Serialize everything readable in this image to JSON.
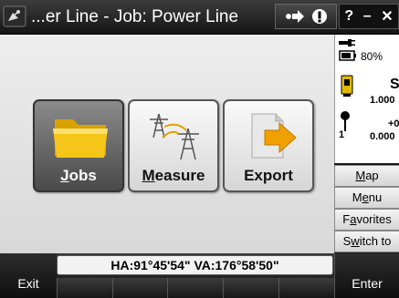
{
  "title": "...er Line - Job: Power Line",
  "titlebar": {
    "help": "?",
    "minimize": "–",
    "close": "✕"
  },
  "tiles": [
    {
      "label_first": "J",
      "label_rest": "obs",
      "icon": "folder-icon"
    },
    {
      "label_first": "M",
      "label_rest": "easure",
      "icon": "survey-towers-icon"
    },
    {
      "label_first": "",
      "label_rest": "Export",
      "icon": "export-arrow-icon"
    }
  ],
  "status": {
    "battery_percent": "80%",
    "s_label": "S",
    "value1": "1.000",
    "plus0": "+0",
    "value2": "0.000",
    "satellite_count": "1"
  },
  "side_buttons": [
    {
      "pre": "",
      "u": "M",
      "post": "ap"
    },
    {
      "pre": "M",
      "u": "e",
      "post": "nu"
    },
    {
      "pre": "F",
      "u": "a",
      "post": "vorites"
    },
    {
      "pre": "S",
      "u": "w",
      "post": "itch to"
    }
  ],
  "readout": "HA:91°45'54\"  VA:176°58'50\"",
  "footer": {
    "exit": "Exit",
    "enter": "Enter"
  },
  "colors": {
    "folder": "#f5c518",
    "export_arrow": "#f0a000"
  }
}
